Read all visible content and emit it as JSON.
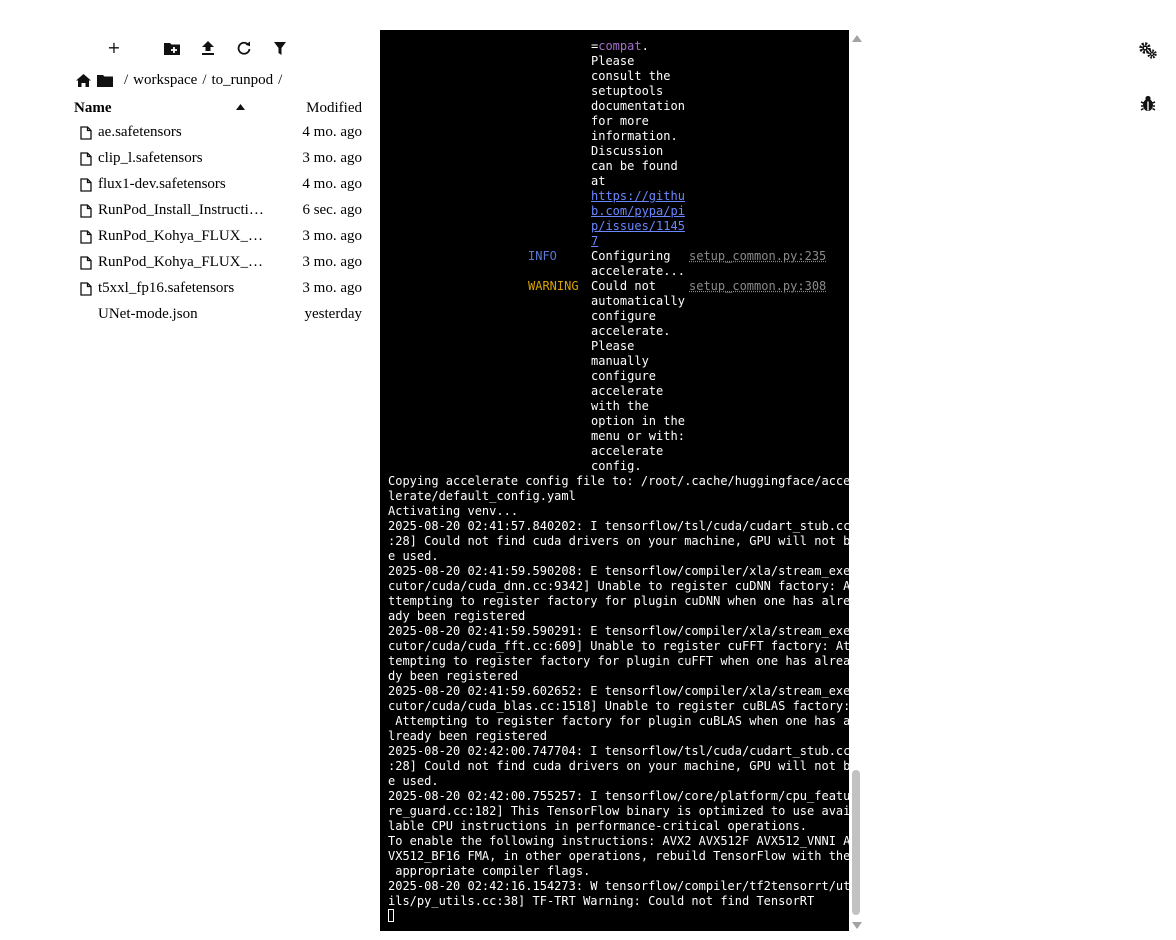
{
  "toolbar": {
    "new_label": "+",
    "icons": [
      "plus-icon",
      "new-folder-icon",
      "upload-icon",
      "refresh-icon",
      "filter-icon"
    ]
  },
  "breadcrumb": {
    "items": [
      "workspace",
      "to_runpod"
    ],
    "separator": "/"
  },
  "file_list": {
    "headers": {
      "name": "Name",
      "modified": "Modified"
    },
    "rows": [
      {
        "name": "ae.safetensors",
        "modified": "4 mo. ago",
        "icon": "file-icon"
      },
      {
        "name": "clip_l.safetensors",
        "modified": "3 mo. ago",
        "icon": "file-icon"
      },
      {
        "name": "flux1-dev.safetensors",
        "modified": "4 mo. ago",
        "icon": "file-icon"
      },
      {
        "name": "RunPod_Install_Instructions.txt",
        "modified": "6 sec. ago",
        "icon": "file-icon"
      },
      {
        "name": "RunPod_Kohya_FLUX_Training.txt",
        "modified": "3 mo. ago",
        "icon": "file-icon"
      },
      {
        "name": "RunPod_Kohya_FLUX_LoRA.txt",
        "modified": "3 mo. ago",
        "icon": "file-icon"
      },
      {
        "name": "t5xxl_fp16.safetensors",
        "modified": "3 mo. ago",
        "icon": "file-icon"
      },
      {
        "name": "UNet-mode.json",
        "modified": "yesterday",
        "icon": "json-icon"
      }
    ]
  },
  "terminal": {
    "col_prefix": "=",
    "col_compat": "compat",
    "col_suffix": ".",
    "col_msg1": [
      "Please",
      "consult the",
      "setuptools",
      "documentation",
      "for more",
      "information.",
      "Discussion",
      "can be found",
      "at"
    ],
    "col_link": [
      "https://githu",
      "b.com/pypa/pi",
      "p/issues/1145",
      "7"
    ],
    "info": {
      "level": "INFO",
      "msg": [
        "Configuring",
        "accelerate..."
      ],
      "src": "setup_common.py:235"
    },
    "warning": {
      "level": "WARNING",
      "msg": [
        "Could not",
        "automatically",
        "configure",
        "accelerate.",
        "Please",
        "manually",
        "configure",
        "accelerate",
        "with the",
        "option in the",
        "menu or with:",
        "accelerate",
        "config."
      ],
      "src": "setup_common.py:308"
    },
    "lines": [
      "Copying accelerate config file to: /root/.cache/huggingface/acce",
      "lerate/default_config.yaml",
      "Activating venv...",
      "2025-08-20 02:41:57.840202: I tensorflow/tsl/cuda/cudart_stub.cc",
      ":28] Could not find cuda drivers on your machine, GPU will not b",
      "e used.",
      "2025-08-20 02:41:59.590208: E tensorflow/compiler/xla/stream_exe",
      "cutor/cuda/cuda_dnn.cc:9342] Unable to register cuDNN factory: A",
      "ttempting to register factory for plugin cuDNN when one has alre",
      "ady been registered",
      "2025-08-20 02:41:59.590291: E tensorflow/compiler/xla/stream_exe",
      "cutor/cuda/cuda_fft.cc:609] Unable to register cuFFT factory: At",
      "tempting to register factory for plugin cuFFT when one has alrea",
      "dy been registered",
      "2025-08-20 02:41:59.602652: E tensorflow/compiler/xla/stream_exe",
      "cutor/cuda/cuda_blas.cc:1518] Unable to register cuBLAS factory:",
      " Attempting to register factory for plugin cuBLAS when one has a",
      "lready been registered",
      "2025-08-20 02:42:00.747704: I tensorflow/tsl/cuda/cudart_stub.cc",
      ":28] Could not find cuda drivers on your machine, GPU will not b",
      "e used.",
      "2025-08-20 02:42:00.755257: I tensorflow/core/platform/cpu_featu",
      "re_guard.cc:182] This TensorFlow binary is optimized to use avai",
      "lable CPU instructions in performance-critical operations.",
      "To enable the following instructions: AVX2 AVX512F AVX512_VNNI A",
      "VX512_BF16 FMA, in other operations, rebuild TensorFlow with the",
      " appropriate compiler flags.",
      "2025-08-20 02:42:16.154273: W tensorflow/compiler/tf2tensorrt/ut",
      "ils/py_utils.cc:38] TF-TRT Warning: Could not find TensorRT"
    ]
  },
  "side_icons": [
    "settings-gears-icon",
    "debug-bug-icon"
  ],
  "colors": {
    "terminal_bg": "#000000",
    "terminal_fg": "#ffffff",
    "info": "#5c78d6",
    "warning": "#d9a400",
    "link": "#6a87ff",
    "compat": "#a36fc9",
    "scroll_thumb": "#c2c2c2"
  }
}
